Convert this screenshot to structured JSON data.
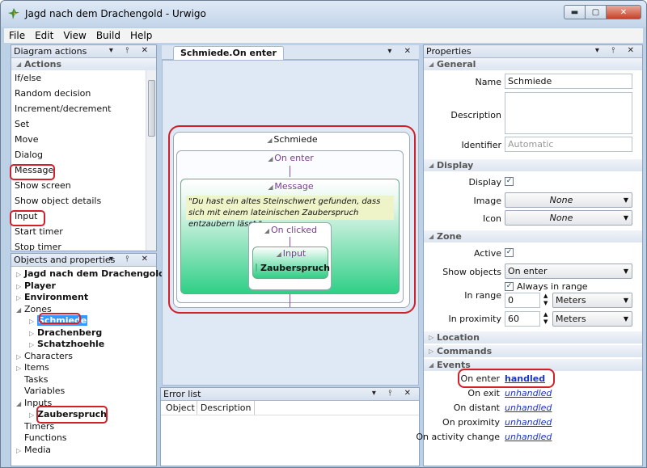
{
  "window": {
    "title": "Jagd nach dem Drachengold - Urwigo"
  },
  "menu": [
    "File",
    "Edit",
    "View",
    "Build",
    "Help"
  ],
  "diagram_actions": {
    "title": "Diagram actions",
    "section": "Actions",
    "items": [
      "If/else",
      "Random decision",
      "Increment/decrement",
      "Set",
      "Move",
      "Dialog",
      "Message",
      "Show screen",
      "Show object details",
      "Input",
      "Start timer",
      "Stop timer"
    ]
  },
  "objects": {
    "title": "Objects and properties",
    "tree": [
      {
        "label": "Jagd nach dem Drachengold",
        "bold": true,
        "level": 0,
        "tri": "▷"
      },
      {
        "label": "Player",
        "bold": true,
        "level": 0,
        "tri": "▷"
      },
      {
        "label": "Environment",
        "bold": true,
        "level": 0,
        "tri": "▷"
      },
      {
        "label": "Zones",
        "bold": false,
        "level": 0,
        "tri": "◢"
      },
      {
        "label": "Schmiede",
        "bold": true,
        "level": 1,
        "tri": "▷",
        "selected": true
      },
      {
        "label": "Drachenberg",
        "bold": true,
        "level": 1,
        "tri": "▷"
      },
      {
        "label": "Schatzhoehle",
        "bold": true,
        "level": 1,
        "tri": "▷"
      },
      {
        "label": "Characters",
        "bold": false,
        "level": 0,
        "tri": "▷"
      },
      {
        "label": "Items",
        "bold": false,
        "level": 0,
        "tri": "▷"
      },
      {
        "label": "Tasks",
        "bold": false,
        "level": 0,
        "tri": ""
      },
      {
        "label": "Variables",
        "bold": false,
        "level": 0,
        "tri": ""
      },
      {
        "label": "Inputs",
        "bold": false,
        "level": 0,
        "tri": "◢"
      },
      {
        "label": "Zauberspruch",
        "bold": true,
        "level": 1,
        "tri": "▷"
      },
      {
        "label": "Timers",
        "bold": false,
        "level": 0,
        "tri": ""
      },
      {
        "label": "Functions",
        "bold": false,
        "level": 0,
        "tri": ""
      },
      {
        "label": "Media",
        "bold": false,
        "level": 0,
        "tri": "▷"
      }
    ]
  },
  "diagram": {
    "tab": "Schmiede.On enter",
    "zone": "Schmiede",
    "event": "On enter",
    "message_title": "Message",
    "message_text": "\"Du hast ein altes Steinschwert gefunden, dass sich mit einem lateinischen Zauberspruch entzaubern lässt.\"",
    "onclicked": "On clicked",
    "input_title": "Input",
    "input_value": "Zauberspruch"
  },
  "error_list": {
    "title": "Error list",
    "columns": [
      "Object",
      "Description"
    ]
  },
  "properties": {
    "title": "Properties",
    "general": "General",
    "name_label": "Name",
    "name_value": "Schmiede",
    "description_label": "Description",
    "identifier_label": "Identifier",
    "identifier_value": "Automatic",
    "display": "Display",
    "display_label": "Display",
    "image_label": "Image",
    "image_value": "None",
    "icon_label": "Icon",
    "icon_value": "None",
    "zone": "Zone",
    "active_label": "Active",
    "show_objects_label": "Show objects",
    "show_objects_value": "On enter",
    "in_range_label": "In range",
    "always_label": "Always in range",
    "in_range_value": "0",
    "in_range_unit": "Meters",
    "in_proximity_label": "In proximity",
    "in_proximity_value": "60",
    "in_proximity_unit": "Meters",
    "location": "Location",
    "commands": "Commands",
    "events": "Events",
    "event_rows": [
      {
        "label": "On enter",
        "value": "handled"
      },
      {
        "label": "On exit",
        "value": "unhandled"
      },
      {
        "label": "On distant",
        "value": "unhandled"
      },
      {
        "label": "On proximity",
        "value": "unhandled"
      },
      {
        "label": "On activity change",
        "value": "unhandled"
      }
    ]
  },
  "colors": {
    "accent_red": "#d0202a",
    "link_blue": "#1a34c4",
    "message_green": "#2fcf86"
  }
}
